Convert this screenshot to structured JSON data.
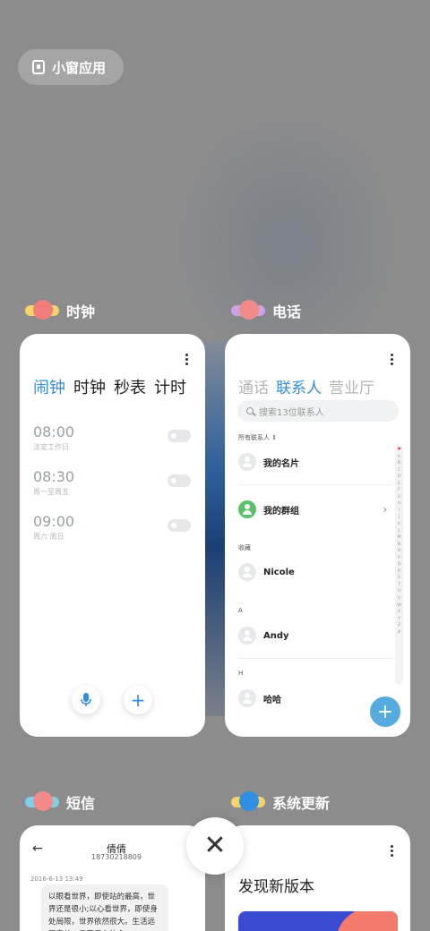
{
  "mini_window": {
    "label": "小窗应用"
  },
  "apps": {
    "clock": {
      "name": "时钟",
      "tabs": [
        "闹钟",
        "时钟",
        "秒表",
        "计时"
      ],
      "alarms": [
        {
          "time": "08:00",
          "repeat": "法定工作日"
        },
        {
          "time": "08:30",
          "repeat": "周一至周五"
        },
        {
          "time": "09:00",
          "repeat": "周六 周日"
        }
      ]
    },
    "phone": {
      "name": "电话",
      "tabs": [
        "通话",
        "联系人",
        "营业厅"
      ],
      "search_placeholder": "搜索13位联系人",
      "filter": "所有联系人",
      "my_card": "我的名片",
      "my_groups": "我的群组",
      "section_favorites": "收藏",
      "favorite_contact": "Nicole",
      "section_a": "A",
      "contact_a": "Andy",
      "section_h": "H",
      "contact_h": "哈哈",
      "index_letters": [
        "A",
        "B",
        "C",
        "D",
        "E",
        "F",
        "G",
        "H",
        "I",
        "J",
        "K",
        "L",
        "M",
        "N",
        "O",
        "P",
        "Q",
        "R",
        "S",
        "T",
        "U",
        "V",
        "W",
        "X",
        "Y",
        "Z",
        "#"
      ]
    },
    "sms": {
      "name": "短信",
      "contact_name": "倩倩",
      "contact_number": "18730218809",
      "date": "2016-6-13 13:49",
      "message": "以眼看世界，即使站的最高，世界还是很小;以心看世界，即使身处局限，世界依然很大。生活远不完美，需要用心体会"
    },
    "update": {
      "name": "系统更新",
      "title": "发现新版本"
    }
  },
  "colors": {
    "accent": "#2f8fe3",
    "fab": "#55aadf",
    "green": "#5bc26b"
  }
}
